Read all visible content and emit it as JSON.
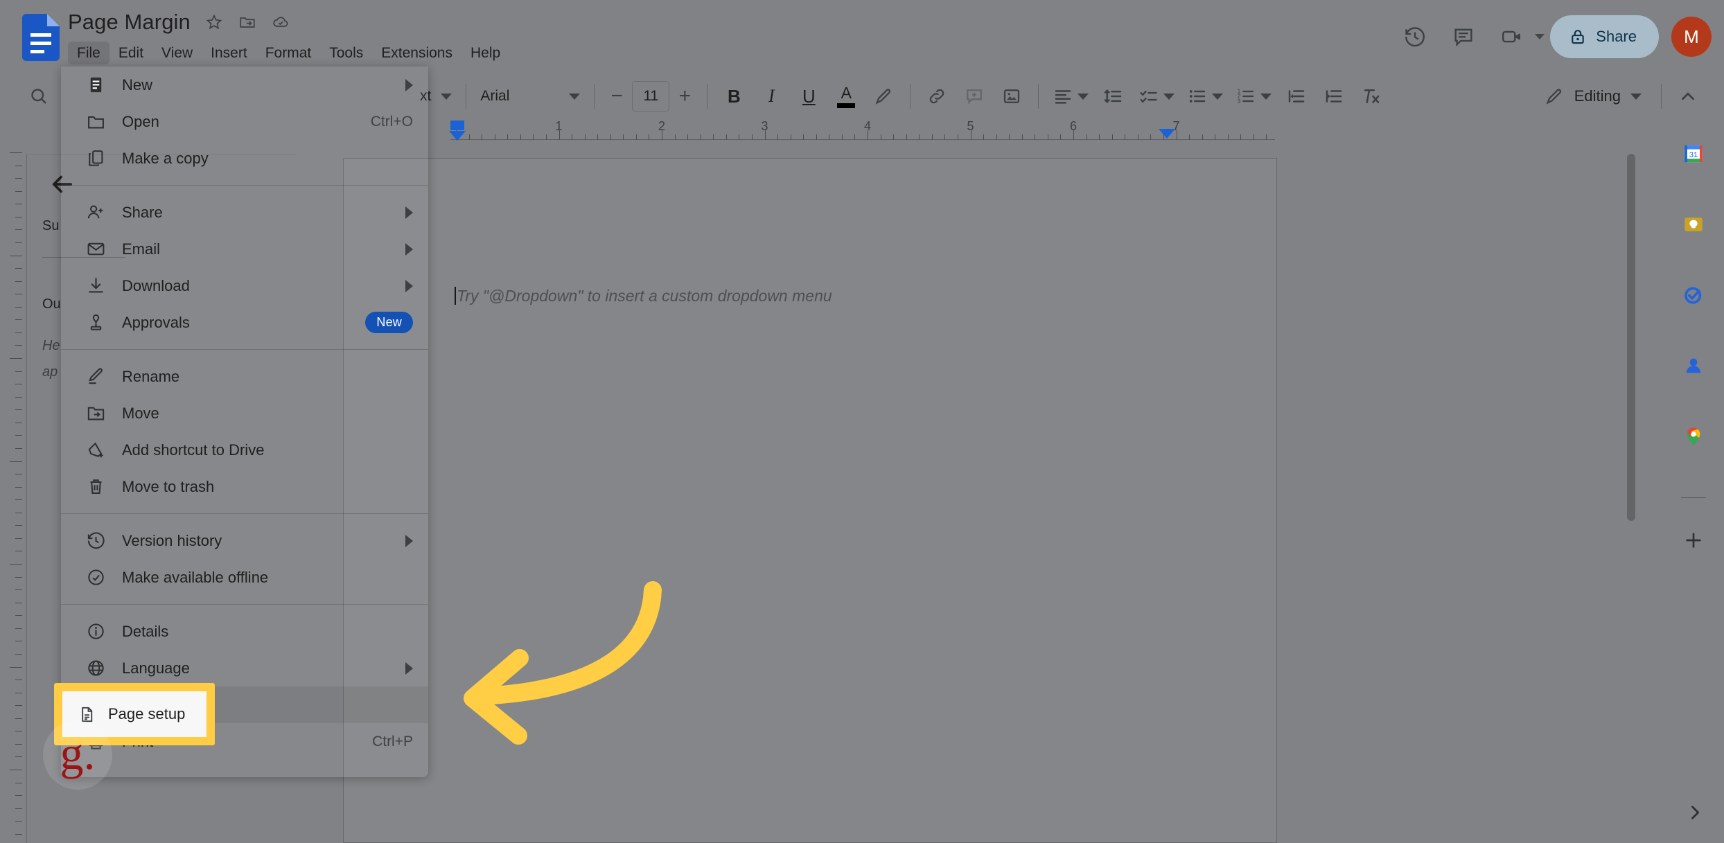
{
  "app": {
    "name": "Google Docs",
    "doc_title": "Page Margin"
  },
  "titlebar": {
    "icons": [
      "star-icon",
      "move-to-folder-icon",
      "saved-to-drive-icon"
    ]
  },
  "menubar": {
    "items": [
      {
        "label": "File",
        "active": true
      },
      {
        "label": "Edit",
        "active": false
      },
      {
        "label": "View",
        "active": false
      },
      {
        "label": "Insert",
        "active": false
      },
      {
        "label": "Format",
        "active": false
      },
      {
        "label": "Tools",
        "active": false
      },
      {
        "label": "Extensions",
        "active": false
      },
      {
        "label": "Help",
        "active": false
      }
    ]
  },
  "top_right": {
    "history_icon": "version-history-icon",
    "comment_icon": "comment-icon",
    "meet_icon": "meet-camera-icon",
    "share_label": "Share",
    "share_lock_icon": "lock-icon",
    "avatar_initial": "M",
    "avatar_color": "#b3391a",
    "share_bg": "#a8bdc9"
  },
  "toolbar": {
    "search_icon": "search-icon",
    "undo_icon": "undo-icon",
    "style": "Normal text",
    "style_truncated": "xt",
    "font": "Arial",
    "font_size": "11",
    "decrease_label": "−",
    "increase_label": "+",
    "bold_label": "B",
    "italic_label": "I",
    "underline_label": "U",
    "text_color_label": "A",
    "text_color_swatch": "#000000",
    "highlight_icon": "highlight-pen-icon",
    "buttons": [
      "link-icon",
      "add-comment-icon",
      "insert-image-icon",
      "align-icon",
      "line-spacing-icon",
      "checklist-icon",
      "bulleted-list-icon",
      "numbered-list-icon",
      "decrease-indent-icon",
      "increase-indent-icon",
      "clear-formatting-icon"
    ],
    "editing_mode": "Editing",
    "editing_pencil_icon": "pencil-icon",
    "collapse_icon": "chevron-up-icon"
  },
  "ruler": {
    "numbers": [
      "1",
      "2",
      "3",
      "4",
      "5",
      "6",
      "7"
    ],
    "left_indent_marker": "indent-marker-left",
    "right_indent_marker": "indent-marker-right"
  },
  "outline_panel": {
    "back_icon": "back-arrow-icon",
    "summary_label": "Su",
    "outline_label": "Ou",
    "hint_line1": "He",
    "hint_line2": "ap"
  },
  "document": {
    "placeholder": "Try \"@Dropdown\" to insert a custom dropdown menu"
  },
  "file_menu": {
    "groups": [
      {
        "items": [
          {
            "label": "New",
            "icon": "new-doc-icon",
            "submenu": true,
            "accel": "",
            "badge": ""
          },
          {
            "label": "Open",
            "icon": "folder-open-icon",
            "submenu": false,
            "accel": "Ctrl+O",
            "badge": ""
          },
          {
            "label": "Make a copy",
            "icon": "copy-icon",
            "submenu": false,
            "accel": "",
            "badge": ""
          }
        ]
      },
      {
        "items": [
          {
            "label": "Share",
            "icon": "person-add-icon",
            "submenu": true,
            "accel": "",
            "badge": ""
          },
          {
            "label": "Email",
            "icon": "envelope-icon",
            "submenu": true,
            "accel": "",
            "badge": ""
          },
          {
            "label": "Download",
            "icon": "download-icon",
            "submenu": true,
            "accel": "",
            "badge": ""
          },
          {
            "label": "Approvals",
            "icon": "approvals-stamp-icon",
            "submenu": false,
            "accel": "",
            "badge": "New"
          }
        ]
      },
      {
        "items": [
          {
            "label": "Rename",
            "icon": "pencil-edit-icon",
            "submenu": false,
            "accel": "",
            "badge": ""
          },
          {
            "label": "Move",
            "icon": "move-folder-icon",
            "submenu": false,
            "accel": "",
            "badge": ""
          },
          {
            "label": "Add shortcut to Drive",
            "icon": "drive-shortcut-icon",
            "submenu": false,
            "accel": "",
            "badge": ""
          },
          {
            "label": "Move to trash",
            "icon": "trash-icon",
            "submenu": false,
            "accel": "",
            "badge": ""
          }
        ]
      },
      {
        "items": [
          {
            "label": "Version history",
            "icon": "version-history-icon",
            "submenu": true,
            "accel": "",
            "badge": ""
          },
          {
            "label": "Make available offline",
            "icon": "offline-check-icon",
            "submenu": false,
            "accel": "",
            "badge": ""
          }
        ]
      },
      {
        "items": [
          {
            "label": "Details",
            "icon": "info-icon",
            "submenu": false,
            "accel": "",
            "badge": ""
          },
          {
            "label": "Language",
            "icon": "globe-icon",
            "submenu": true,
            "accel": "",
            "badge": ""
          },
          {
            "label": "Page setup",
            "icon": "page-setup-icon",
            "submenu": false,
            "accel": "",
            "badge": ""
          },
          {
            "label": "Print",
            "icon": "printer-icon",
            "submenu": false,
            "accel": "Ctrl+P",
            "badge": ""
          }
        ]
      }
    ]
  },
  "highlight": {
    "label": "Page setup",
    "icon": "page-setup-icon",
    "border_color": "#FFCC44",
    "fill_color": "#f7f7f7"
  },
  "annotation": {
    "arrow_color": "#FFCE44",
    "arrow_direction": "left"
  },
  "watermark": {
    "text": "g.",
    "color": "#9b1414"
  },
  "right_rail": {
    "items": [
      {
        "icon": "google-calendar-icon",
        "label": "Calendar"
      },
      {
        "icon": "google-keep-icon",
        "label": "Keep"
      },
      {
        "icon": "google-tasks-icon",
        "label": "Tasks"
      },
      {
        "icon": "google-contacts-icon",
        "label": "Contacts"
      },
      {
        "icon": "google-maps-icon",
        "label": "Maps"
      },
      {
        "icon": "add-addon-icon",
        "label": "Get add-ons"
      }
    ],
    "expand_icon": "chevron-right-icon"
  }
}
